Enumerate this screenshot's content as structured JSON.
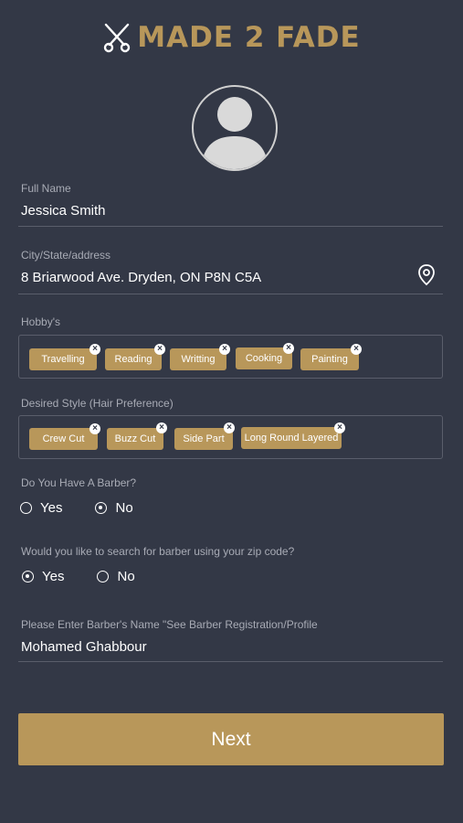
{
  "header": {
    "logo_text": "MADE 2 FADE",
    "logo_icon": "scissors-icon",
    "brand_color": "#b8975a"
  },
  "profile": {
    "avatar_icon": "user-avatar-icon"
  },
  "form": {
    "full_name": {
      "label": "Full Name",
      "value": "Jessica Smith"
    },
    "address": {
      "label": "City/State/address",
      "value": "8 Briarwood Ave. Dryden, ON P8N C5A",
      "icon": "location-pin-icon"
    },
    "hobbies": {
      "label": "Hobby's",
      "tags": [
        "Travelling",
        "Reading",
        "Writting",
        "Cooking",
        "Painting"
      ]
    },
    "styles": {
      "label": "Desired Style (Hair Preference)",
      "tags": [
        "Crew Cut",
        "Buzz Cut",
        "Side Part",
        "Long Round Layered"
      ]
    },
    "has_barber": {
      "label": "Do You Have A Barber?",
      "options": [
        "Yes",
        "No"
      ],
      "selected": "No"
    },
    "zip_search": {
      "label": "Would you like to search for barber using your zip code?",
      "options": [
        "Yes",
        "No"
      ],
      "selected": "Yes"
    },
    "barber_name": {
      "label": "Please Enter Barber's Name \"See Barber Registration/Profile",
      "value": "Mohamed Ghabbour"
    }
  },
  "next_button": {
    "label": "Next"
  }
}
